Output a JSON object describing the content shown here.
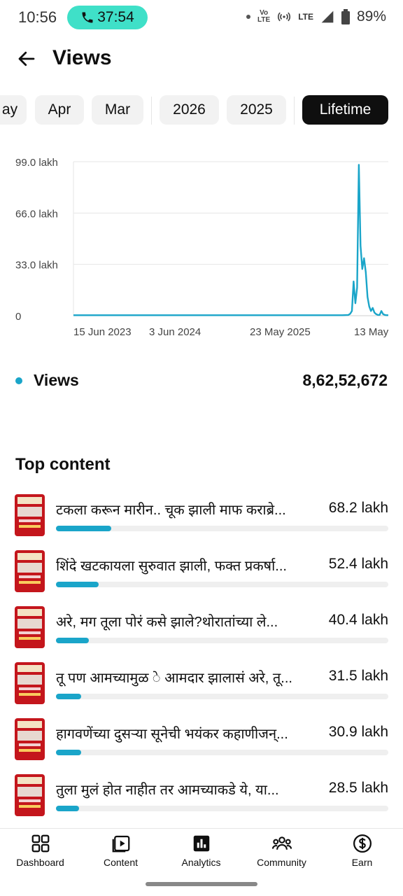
{
  "status_bar": {
    "time": "10:56",
    "call_timer": "37:54",
    "network_tag": "LTE",
    "battery": "89%",
    "pill_color": "#3fe0c8"
  },
  "header": {
    "title": "Views",
    "back_icon": "arrow-left-icon"
  },
  "filters": {
    "chips": [
      "ay",
      "Apr",
      "Mar",
      "2026",
      "2025",
      "Lifetime"
    ],
    "selected": "Lifetime"
  },
  "chart_data": {
    "type": "line",
    "y_tick_labels": [
      "99.0 lakh",
      "66.0 lakh",
      "33.0 lakh",
      "0"
    ],
    "ylim": [
      0,
      99
    ],
    "ylabel_unit": "lakh",
    "x_tick_labels": [
      "15 Jun 2023",
      "3 Jun 2024",
      "23 May 2025",
      "13 May"
    ],
    "grid": true,
    "series": [
      {
        "name": "Views",
        "color": "#1aa5c9",
        "values": [
          0.3,
          0.3,
          0.3,
          0.3,
          0.3,
          0.3,
          0.3,
          0.3,
          0.3,
          0.3,
          0.3,
          0.3,
          0.3,
          0.3,
          0.3,
          0.3,
          0.3,
          0.3,
          0.3,
          0.3,
          0.3,
          0.3,
          0.3,
          0.3,
          0.3,
          0.3,
          0.3,
          0.3,
          0.3,
          0.3,
          0.3,
          0.3,
          0.3,
          0.3,
          0.3,
          0.3,
          0.3,
          0.3,
          0.3,
          0.3,
          0.3,
          0.3,
          0.3,
          0.3,
          0.3,
          0.3,
          0.5,
          1.2,
          3.0,
          22.0,
          8.0,
          18.0,
          97.0,
          45.0,
          30.0,
          37.0,
          28.0,
          12.0,
          6.0,
          3.0,
          5.0,
          2.0,
          1.0,
          0.5,
          0.5,
          3.0,
          1.0,
          0.5,
          0.3,
          0.3
        ]
      }
    ]
  },
  "summary": {
    "label": "Views",
    "value": "8,62,52,672",
    "dot_color": "#1aa5c9"
  },
  "top_content": {
    "title": "Top content",
    "items": [
      {
        "title": "टकला करून मारीन.. चूक झाली माफ कराब्रे...",
        "value": "68.2 lakh",
        "share": 68.2
      },
      {
        "title": "शिंदे खटकायला सुरुवात झाली, फक्त प्रकर्षा...",
        "value": "52.4 lakh",
        "share": 52.4
      },
      {
        "title": "अरे, मग तूला पोरं कसे झाले?थोरातांच्या ले...",
        "value": "40.4 lakh",
        "share": 40.4
      },
      {
        "title": "तू पण आमच्यामुळ े आमदार झालासं अरे, तू...",
        "value": "31.5 lakh",
        "share": 31.5
      },
      {
        "title": "हागवणेंच्या दुसऱ्या सूनेची भयंकर कहाणीजन्...",
        "value": "30.9 lakh",
        "share": 30.9
      },
      {
        "title": "तुला मुलं होत नाहीत तर आमच्याकडे ये, या...",
        "value": "28.5 lakh",
        "share": 28.5
      }
    ]
  },
  "bottom_nav": {
    "items": [
      {
        "label": "Dashboard",
        "icon": "dashboard-icon"
      },
      {
        "label": "Content",
        "icon": "content-icon"
      },
      {
        "label": "Analytics",
        "icon": "analytics-icon"
      },
      {
        "label": "Community",
        "icon": "community-icon"
      },
      {
        "label": "Earn",
        "icon": "earn-icon"
      }
    ],
    "active": "Analytics"
  }
}
